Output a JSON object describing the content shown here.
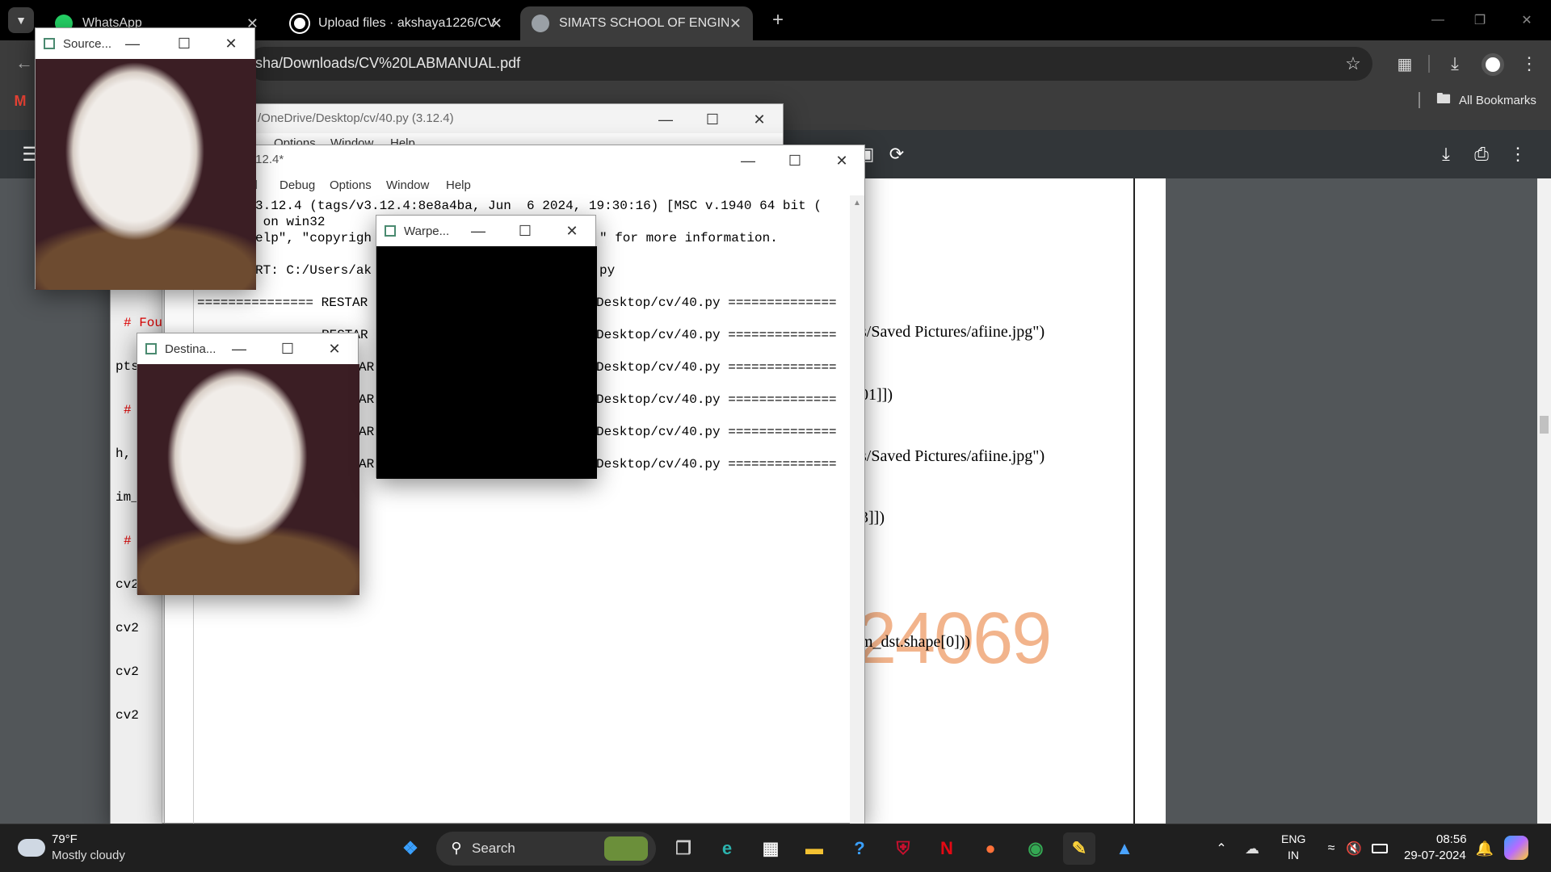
{
  "browser": {
    "tabs": [
      {
        "title": "WhatsApp",
        "active": false
      },
      {
        "title": "Upload files · akshaya1226/CV",
        "active": false
      },
      {
        "title": "SIMATS SCHOOL OF ENGINEERI",
        "active": true
      }
    ],
    "new_tab": "+",
    "address": "sha/Downloads/CV%20LABMANUAL.pdf",
    "bookmarks_label": "All Bookmarks"
  },
  "pdf": {
    "lines": [
      "s/Saved Pictures/afiine.jpg\")",
      "01]])",
      "s/Saved Pictures/afiine.jpg\")",
      "3]])",
      "m_dst.shape[0]))"
    ],
    "watermark": "24069"
  },
  "idle_editor": {
    "title": "/OneDrive/Desktop/cv/40.py (3.12.4)",
    "menu": [
      "Options",
      "Window",
      "Help"
    ],
    "code_lines": [
      "# Fou",
      "pts_ds",
      "# Cal",
      "h, ",
      "im_",
      "# ",
      "cv2",
      "cv2",
      "cv2",
      "cv2"
    ]
  },
  "idle_shell": {
    "title": ".12.4*",
    "menu": [
      "ll",
      "Debug",
      "Options",
      "Window",
      "Help"
    ],
    "lines": [
      "3.12.4 (tags/v3.12.4:8e8a4ba, Jun  6 2024, 19:30:16) [MSC v.1940 64 bit (",
      " on win32",
      "elp\", \"copyrigh",
      "RT: C:/Users/ak",
      "=============== RESTAR",
      "RESTAR",
      "AR",
      "AR",
      "AR",
      "AR"
    ],
    "right_lines": [
      "\" for more information.",
      "py",
      "Desktop/cv/40.py ==============",
      "Desktop/cv/40.py ==============",
      "Desktop/cv/40.py ==============",
      "Desktop/cv/40.py ==============",
      "Desktop/cv/40.py ==============",
      "Desktop/cv/40.py =============="
    ]
  },
  "cv_windows": {
    "source": "Source...",
    "destination": "Destina...",
    "warped": "Warpe..."
  },
  "taskbar": {
    "weather_temp": "79°F",
    "weather_desc": "Mostly cloudy",
    "search_label": "Search",
    "lang_top": "ENG",
    "lang_bottom": "IN",
    "time": "08:56",
    "date": "29-07-2024"
  }
}
